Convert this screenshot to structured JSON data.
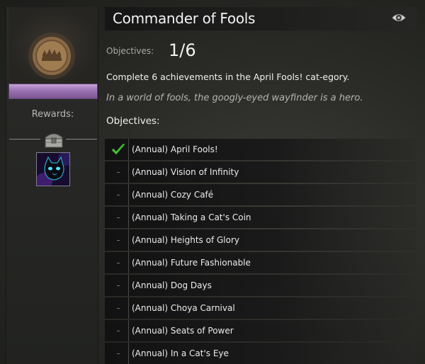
{
  "header": {
    "title": "Commander of Fools"
  },
  "progress": {
    "label": "Objectives:",
    "count": "1/6",
    "completed": 1,
    "total": 6
  },
  "description": "Complete 6 achievements in the April Fools! cat-egory.",
  "flavor_text": "In a world of fools, the googly-eyed wayfinder is a hero.",
  "objectives_heading": "Objectives:",
  "sidebar": {
    "rewards_label": "Rewards:",
    "bar_color": "#a57fbe",
    "emblem_icon": "achievement-emblem-icon",
    "reward_icon": "cat-mini-icon"
  },
  "objectives": [
    {
      "label": "(Annual) April Fools!",
      "done": true
    },
    {
      "label": "(Annual) Vision of Infinity",
      "done": false
    },
    {
      "label": "(Annual) Cozy Café",
      "done": false
    },
    {
      "label": "(Annual) Taking a Cat's Coin",
      "done": false
    },
    {
      "label": "(Annual) Heights of Glory",
      "done": false
    },
    {
      "label": "(Annual) Future Fashionable",
      "done": false
    },
    {
      "label": "(Annual) Dog Days",
      "done": false
    },
    {
      "label": "(Annual) Choya Carnival",
      "done": false
    },
    {
      "label": "(Annual) Seats of Power",
      "done": false
    },
    {
      "label": "(Annual) In a Cat's Eye",
      "done": false
    }
  ],
  "colors": {
    "check": "#4fcf3a",
    "accent_purple": "#a57fbe"
  }
}
